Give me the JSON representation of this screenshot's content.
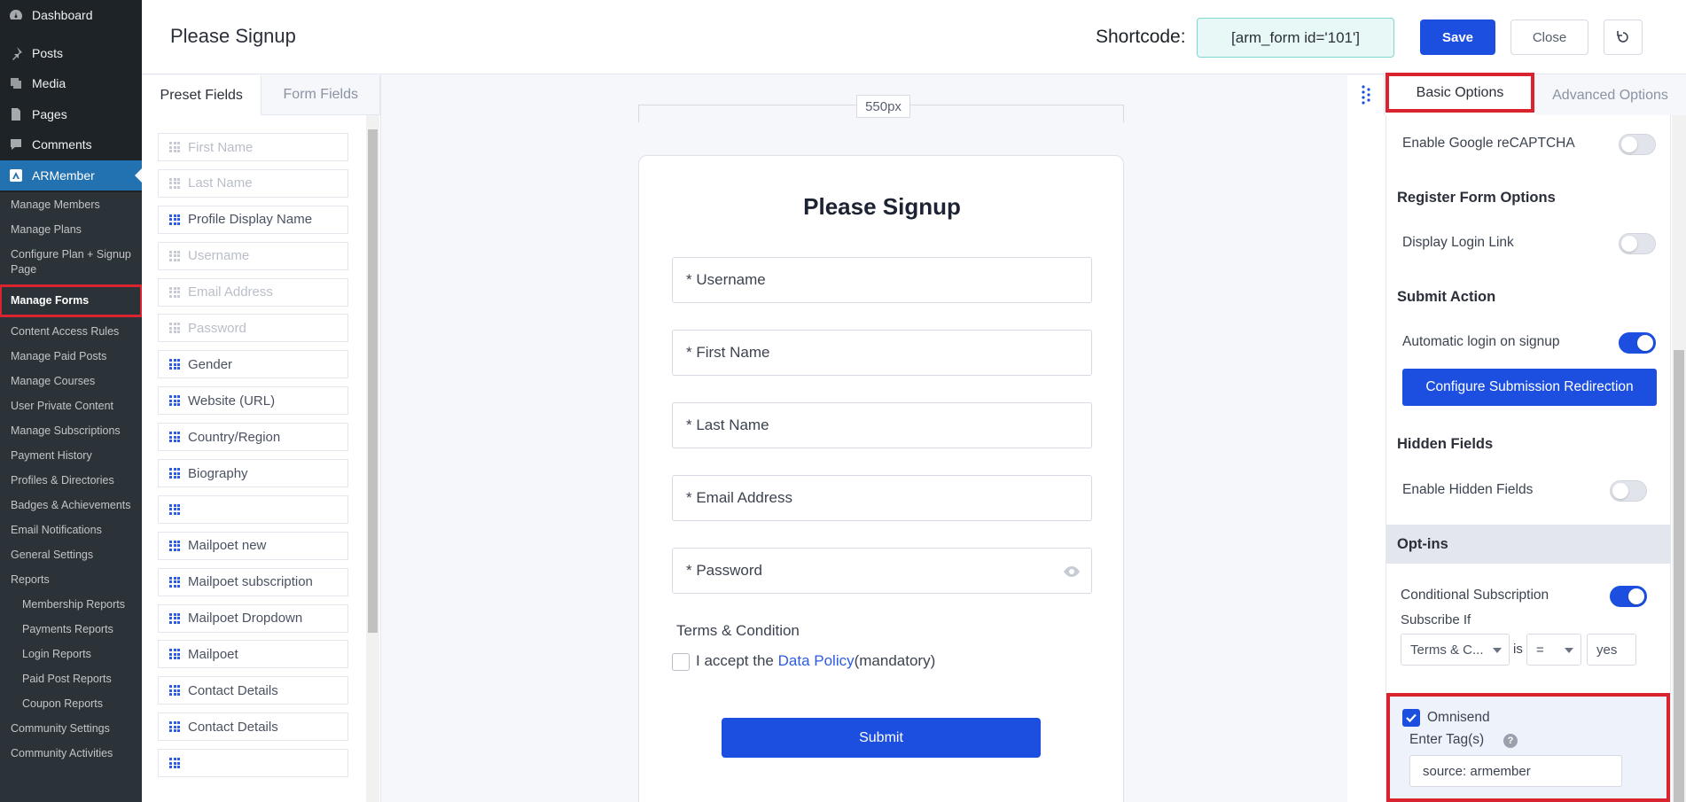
{
  "wp_menu": {
    "items": [
      {
        "label": "Dashboard",
        "icon": "dashboard-icon"
      },
      {
        "label": "Posts",
        "icon": "pin-icon"
      },
      {
        "label": "Media",
        "icon": "media-icon"
      },
      {
        "label": "Pages",
        "icon": "pages-icon"
      },
      {
        "label": "Comments",
        "icon": "comment-icon"
      },
      {
        "label": "ARMember",
        "icon": "armember-icon"
      }
    ],
    "submenu": [
      "Manage Members",
      "Manage Plans",
      "Configure Plan + Signup Page",
      "Manage Forms",
      "Content Access Rules",
      "Manage Paid Posts",
      "Manage Courses",
      "User Private Content",
      "Manage Subscriptions",
      "Payment History",
      "Profiles & Directories",
      "Badges & Achievements",
      "Email Notifications",
      "General Settings",
      "Reports"
    ],
    "reports": [
      "Membership Reports",
      "Payments Reports",
      "Login Reports",
      "Paid Post Reports",
      "Coupon Reports"
    ],
    "after": [
      "Community Settings",
      "Community Activities"
    ]
  },
  "header": {
    "title": "Please Signup",
    "shortcode_label": "Shortcode:",
    "shortcode_value": "[arm_form id='101']",
    "save_label": "Save",
    "close_label": "Close"
  },
  "fields_panel": {
    "tab_preset": "Preset Fields",
    "tab_form": "Form Fields",
    "fields": [
      {
        "label": "First Name",
        "disabled": true
      },
      {
        "label": "Last Name",
        "disabled": true
      },
      {
        "label": "Profile Display Name",
        "disabled": false
      },
      {
        "label": "Username",
        "disabled": true
      },
      {
        "label": "Email Address",
        "disabled": true
      },
      {
        "label": "Password",
        "disabled": true
      },
      {
        "label": "Gender",
        "disabled": false
      },
      {
        "label": "Website (URL)",
        "disabled": false
      },
      {
        "label": "Country/Region",
        "disabled": false
      },
      {
        "label": "Biography",
        "disabled": false
      },
      {
        "label": "",
        "disabled": false
      },
      {
        "label": "Mailpoet new",
        "disabled": false
      },
      {
        "label": "Mailpoet subscription",
        "disabled": false
      },
      {
        "label": "Mailpoet Dropdown",
        "disabled": false
      },
      {
        "label": "Mailpoet",
        "disabled": false
      },
      {
        "label": "Contact Details",
        "disabled": false
      },
      {
        "label": "Contact Details",
        "disabled": false
      },
      {
        "label": "",
        "disabled": false
      }
    ]
  },
  "canvas": {
    "width_label": "550px",
    "form_title": "Please Signup",
    "inputs": [
      "* Username",
      "* First Name",
      "* Last Name",
      "* Email Address",
      "* Password"
    ],
    "terms_label": "Terms & Condition",
    "terms_prefix": "I accept the ",
    "terms_link": "Data Policy",
    "terms_suffix": "(mandatory)",
    "submit_label": "Submit"
  },
  "options": {
    "tab_basic": "Basic Options",
    "tab_advanced": "Advanced Options",
    "recaptcha_label": "Enable Google reCAPTCHA",
    "recaptcha_on": false,
    "register_heading": "Register Form Options",
    "login_link_label": "Display Login Link",
    "login_link_on": false,
    "submit_heading": "Submit Action",
    "auto_login_label": "Automatic login on signup",
    "auto_login_on": true,
    "redirect_button": "Configure Submission Redirection",
    "hidden_heading": "Hidden Fields",
    "hidden_label": "Enable Hidden Fields",
    "hidden_on": false,
    "optins_heading": "Opt-ins",
    "cond_sub_label": "Conditional Subscription",
    "cond_sub_on": true,
    "subscribe_if_label": "Subscribe If",
    "cond_field": "Terms & C...",
    "cond_is": "is",
    "cond_op": "=",
    "cond_value": "yes",
    "omnisend_label": "Omnisend",
    "omnisend_checked": true,
    "tags_label": "Enter Tag(s)",
    "tags_value": "source: armember"
  },
  "colors": {
    "primary": "#1c4fe0",
    "highlight": "#d9232e",
    "wp_sidebar": "#1d2327",
    "wp_active": "#2271b1"
  }
}
